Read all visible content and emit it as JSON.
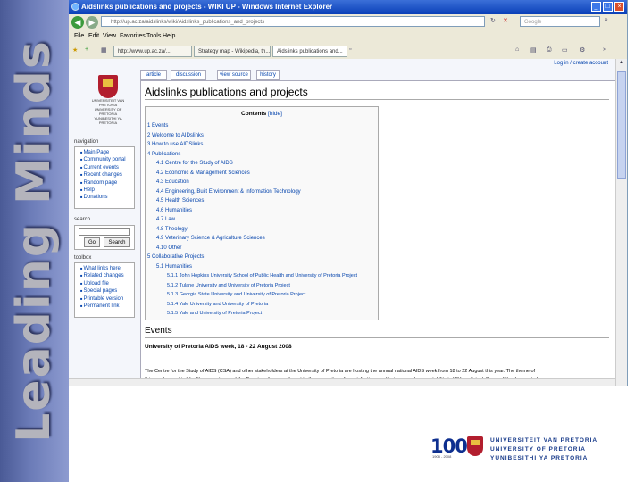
{
  "slide": {
    "side_title": "Leading Minds"
  },
  "browser": {
    "window_title": "Aidslinks publications and projects - WIKI UP - Windows Internet Explorer",
    "address": "http://up.ac.za/aidslinks/wiki/Aidslinks_publications_and_projects",
    "search_placeholder": "Google",
    "menu": [
      "File",
      "Edit",
      "View",
      "Favorites",
      "Tools",
      "Help"
    ],
    "tabs": [
      "http://www.up.ac.za/...",
      "Strategy map - Wikipedia, th...",
      "Aidslinks publications and..."
    ]
  },
  "wiki": {
    "logo_lines": [
      "UNIVERSITEIT VAN PRETORIA",
      "UNIVERSITY OF PRETORIA",
      "YUNIBESITHI YA PRETORIA"
    ],
    "page_tabs": [
      "article",
      "discussion",
      "view source",
      "history"
    ],
    "personal": "Log in / create account",
    "navigation": {
      "heading": "navigation",
      "items": [
        "Main Page",
        "Community portal",
        "Current events",
        "Recent changes",
        "Random page",
        "Help",
        "Donations"
      ]
    },
    "search": {
      "heading": "search",
      "go": "Go",
      "search": "Search"
    },
    "toolbox": {
      "heading": "toolbox",
      "items": [
        "What links here",
        "Related changes",
        "Upload file",
        "Special pages",
        "Printable version",
        "Permanent link"
      ]
    },
    "title": "Aidslinks publications and projects",
    "toc": {
      "title": "Contents",
      "hide": "[hide]",
      "entries": [
        "1 Events",
        "2 Welcome to AIDslinks",
        "3 How to use AIDSlinks",
        "4 Publications",
        "4.1 Centre for the Study of AIDS",
        "4.2 Economic & Management Sciences",
        "4.3 Education",
        "4.4 Engineering, Built Environment & Information Technology",
        "4.5 Health Sciences",
        "4.6 Humanities",
        "4.7 Law",
        "4.8 Theology",
        "4.9 Veterinary Science & Agriculture Sciences",
        "4.10 Other",
        "5 Collaborative Projects",
        "5.1 Humanities",
        "5.1.1 John Hopkins University School of Public Health and University of Pretoria Project",
        "5.1.2 Tulane University and University of Pretoria Project",
        "5.1.3 Georgia State University and University of Pretoria Project",
        "5.1.4 Yale University and University of Pretoria",
        "5.1.5 Yale and University of Pretoria Project"
      ]
    },
    "events": {
      "heading": "Events",
      "subheading": "University of Pretoria AIDS week, 18 - 22 August 2008",
      "text_lines": [
        "The Centre for the Study of AIDS (CSA) and other stakeholders at the University of Pretoria are hosting the annual national AIDS week from 18 to 22 August this year. The theme of",
        "this year's event is 'Health, Innovation and the Promise of a commitment to the prevention of new infections and to increased accountability in HIV medicine'. Some of the themes to be"
      ]
    }
  },
  "footer": {
    "centenary": "100",
    "centenary_years": "1908 - 2008",
    "university_lines": [
      "UNIVERSITEIT VAN PRETORIA",
      "UNIVERSITY OF PRETORIA",
      "YUNIBESITHI YA PRETORIA"
    ]
  }
}
